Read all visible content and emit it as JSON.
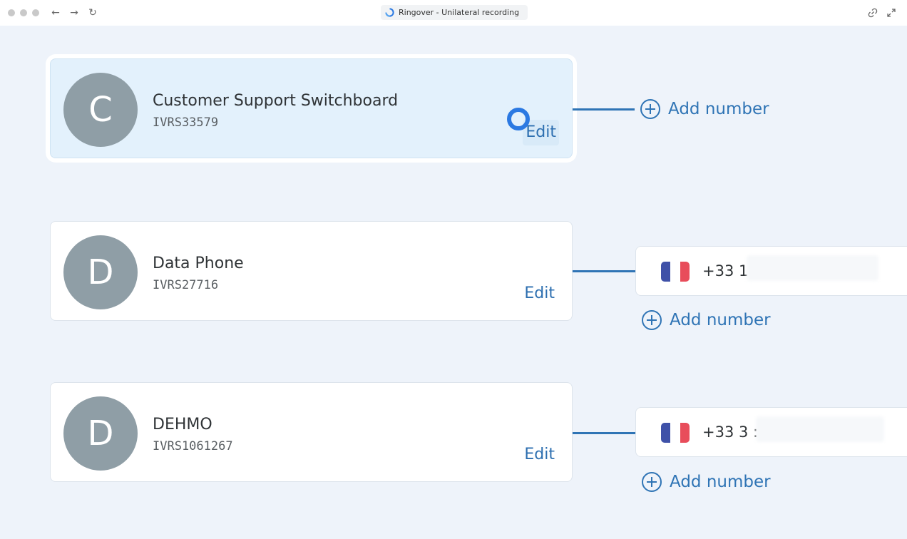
{
  "browser": {
    "tab_title": "Ringover - Unilateral recording",
    "back_icon": "←",
    "forward_icon": "→",
    "reload_icon": "↻",
    "link_icon": "⊘",
    "expand_icon": "⤢"
  },
  "colors": {
    "accent": "#2f74b5",
    "avatar": "#8f9ea6",
    "background": "#eef3fa",
    "active_card": "#e3f1fc"
  },
  "ivrs": [
    {
      "initial": "C",
      "name": "Customer Support Switchboard",
      "id": "IVRS33579",
      "edit_label": "Edit",
      "add_number_label": "Add number"
    },
    {
      "initial": "D",
      "name": "Data Phone",
      "id": "IVRS27716",
      "edit_label": "Edit",
      "phone_number": "+33 1",
      "add_number_label": "Add number"
    },
    {
      "initial": "D",
      "name": "DEHMO",
      "id": "IVRS1061267",
      "edit_label": "Edit",
      "phone_number": "+33 3 :",
      "add_number_label": "Add number"
    }
  ]
}
